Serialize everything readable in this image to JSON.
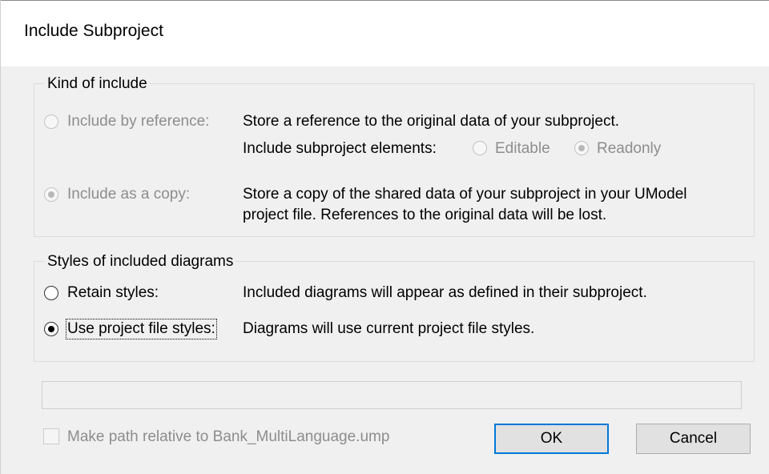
{
  "dialog": {
    "title": "Include Subproject"
  },
  "kind_of_include": {
    "legend": "Kind of include",
    "by_reference": {
      "label": "Include by reference:",
      "description": "Store a reference to the original data of your subproject.",
      "elements_label": "Include subproject elements:",
      "editable_label": "Editable",
      "readonly_label": "Readonly",
      "selected_element_mode": "Readonly"
    },
    "as_copy": {
      "label": "Include as a copy:",
      "description_line1": "Store a copy of the shared data of your subproject in your UModel",
      "description_line2": "project file. References to the original data will be lost."
    },
    "selected": "as_copy"
  },
  "styles": {
    "legend": "Styles of included diagrams",
    "retain": {
      "label": "Retain styles:",
      "description": "Included diagrams will appear as defined in their subproject."
    },
    "project": {
      "label": "Use project file styles:",
      "description": "Diagrams will use current project file styles."
    },
    "selected": "project"
  },
  "path_field": {
    "value": ""
  },
  "relative_path": {
    "label": "Make path relative to Bank_MultiLanguage.ump",
    "checked": false
  },
  "buttons": {
    "ok_label": "OK",
    "cancel_label": "Cancel"
  },
  "colors": {
    "default_button_border": "#0078d7",
    "disabled_text": "#8d8d8d",
    "dialog_background": "#f0f0f0"
  }
}
